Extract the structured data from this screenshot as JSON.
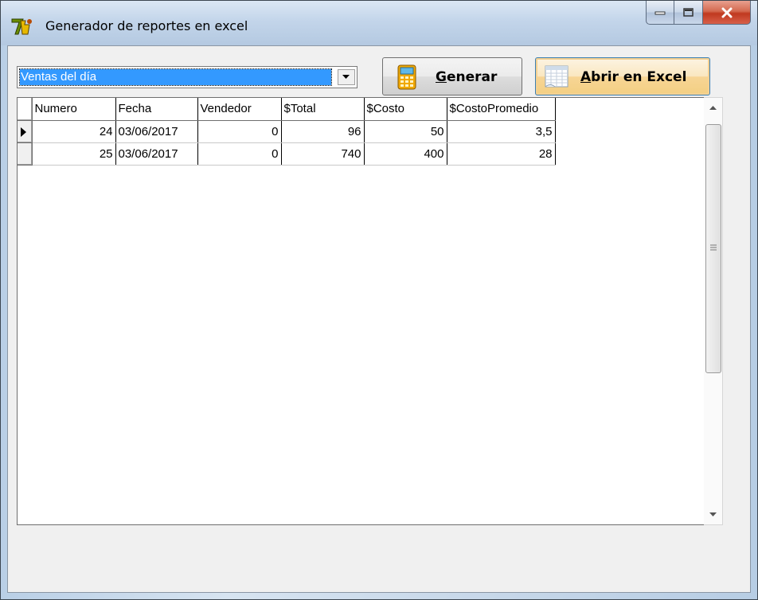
{
  "window": {
    "title": "Generador de reportes en excel"
  },
  "report_select": {
    "value": "Ventas del día"
  },
  "buttons": {
    "generate_label_accel": "G",
    "generate_label_rest": "enerar",
    "excel_label_accel": "A",
    "excel_label_rest": "brir en Excel"
  },
  "table": {
    "headers": [
      "Numero",
      "Fecha",
      "Vendedor",
      "$Total",
      "$Costo",
      "$CostoPromedio"
    ],
    "rows": [
      [
        "24",
        "03/06/2017",
        "0",
        "96",
        "50",
        "3,5"
      ],
      [
        "25",
        "03/06/2017",
        "0",
        "740",
        "400",
        "28"
      ]
    ],
    "current_row": 0
  },
  "icons": {
    "app": "app-logo-icon",
    "generate": "calculator-icon",
    "excel": "spreadsheet-icon"
  },
  "colors": {
    "selection": "#3399ff",
    "close_button": "#c0391f",
    "default_button_border": "#3c7fb1"
  }
}
